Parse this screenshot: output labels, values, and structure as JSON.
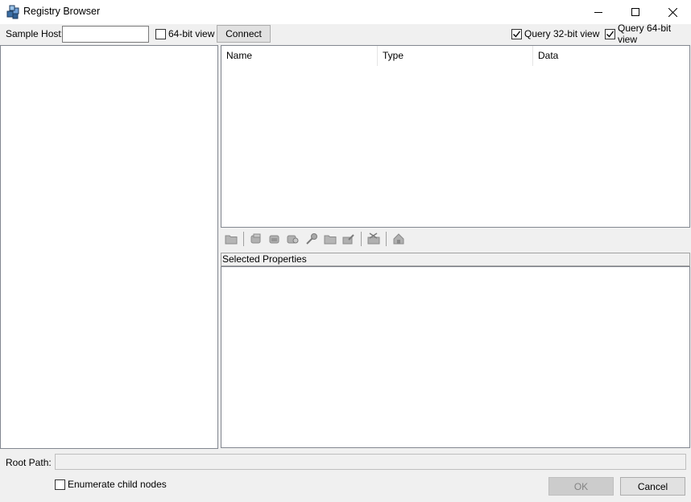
{
  "window": {
    "title": "Registry Browser",
    "icon": "registry-cubes-icon",
    "controls": [
      "minimize-icon",
      "maximize-icon",
      "close-icon"
    ]
  },
  "toolbar": {
    "sample_host_label": "Sample Host:",
    "sample_host_value": "",
    "view64_label": "64-bit view",
    "view64_checked": false,
    "connect_label": "Connect",
    "query32_label": "Query 32-bit view",
    "query32_checked": true,
    "query64_label": "Query 64-bit view",
    "query64_checked": true
  },
  "list": {
    "columns": [
      "Name",
      "Type",
      "Data"
    ],
    "rows": []
  },
  "icon_toolbar": {
    "icons": [
      "folder-icon",
      "new-key-icon",
      "new-value-icon",
      "find-icon",
      "key-icon",
      "open-folder-icon",
      "edit-icon",
      "delete-icon",
      "home-icon"
    ],
    "enabled": false
  },
  "properties": {
    "header": "Selected Properties"
  },
  "root": {
    "label": "Root Path:",
    "value": ""
  },
  "footer": {
    "enumerate_label": "Enumerate child nodes",
    "enumerate_checked": false,
    "ok_label": "OK",
    "cancel_label": "Cancel"
  },
  "colors": {
    "background": "#f0f0f0",
    "pane_border": "#828790",
    "disabled_text": "#838383",
    "icon_disabled": "#9a9a9a"
  }
}
